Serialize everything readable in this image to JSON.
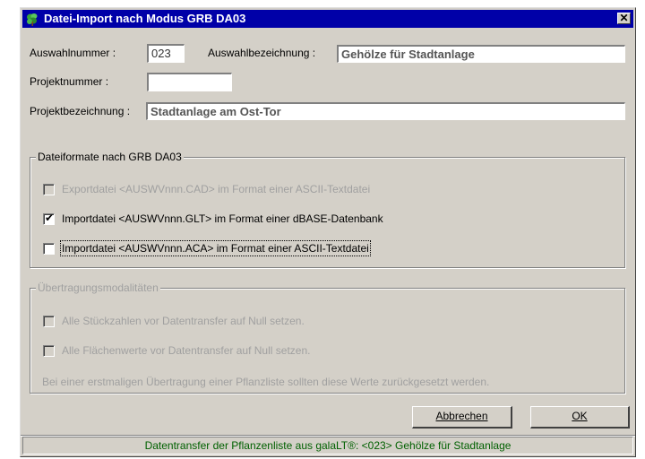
{
  "window": {
    "title": "Datei-Import nach Modus GRB DA03",
    "close_symbol": "✕",
    "icon": "leaf-icon"
  },
  "form": {
    "auswahlnummer_label": "Auswahlnummer :",
    "auswahlnummer_value": "023",
    "auswahlbezeichnung_label": "Auswahlbezeichnung :",
    "auswahlbezeichnung_value": "Gehölze für Stadtanlage",
    "projektnummer_label": "Projektnummer :",
    "projektnummer_value": "",
    "projektbezeichnung_label": "Projektbezeichnung :",
    "projektbezeichnung_value": "Stadtanlage am Ost-Tor"
  },
  "formats_group": {
    "title": "Dateiformate nach GRB DA03",
    "options": [
      {
        "label": "Exportdatei  <AUSWVnnn.CAD>   im Format einer ASCII-Textdatei",
        "checked": false,
        "enabled": false
      },
      {
        "label": "Importdatei <AUSWVnnn.GLT>  im Format einer dBASE-Datenbank",
        "checked": true,
        "enabled": true
      },
      {
        "label": "Importdatei  <AUSWVnnn.ACA>   im Format einer ASCII-Textdatei",
        "checked": false,
        "enabled": true,
        "focused": true
      }
    ]
  },
  "transfer_group": {
    "title": "Übertragungsmodalitäten",
    "options": [
      {
        "label": "Alle Stückzahlen vor Datentransfer auf Null setzen.",
        "checked": false,
        "enabled": false
      },
      {
        "label": "Alle Flächenwerte vor Datentransfer auf Null setzen.",
        "checked": false,
        "enabled": false
      }
    ],
    "note": "Bei einer erstmaligen Übertragung einer Pflanzliste sollten diese Werte zurückgesetzt werden."
  },
  "buttons": {
    "cancel": "Abbrechen",
    "ok": "OK"
  },
  "status": {
    "text": "Datentransfer der Pflanzenliste aus galaLT®:  <023>    Gehölze für Stadtanlage",
    "color": "#006000"
  },
  "colors": {
    "titlebar": "#0000a8",
    "dialog": "#d4d0c8",
    "disabled_text": "#a0a0a0"
  }
}
